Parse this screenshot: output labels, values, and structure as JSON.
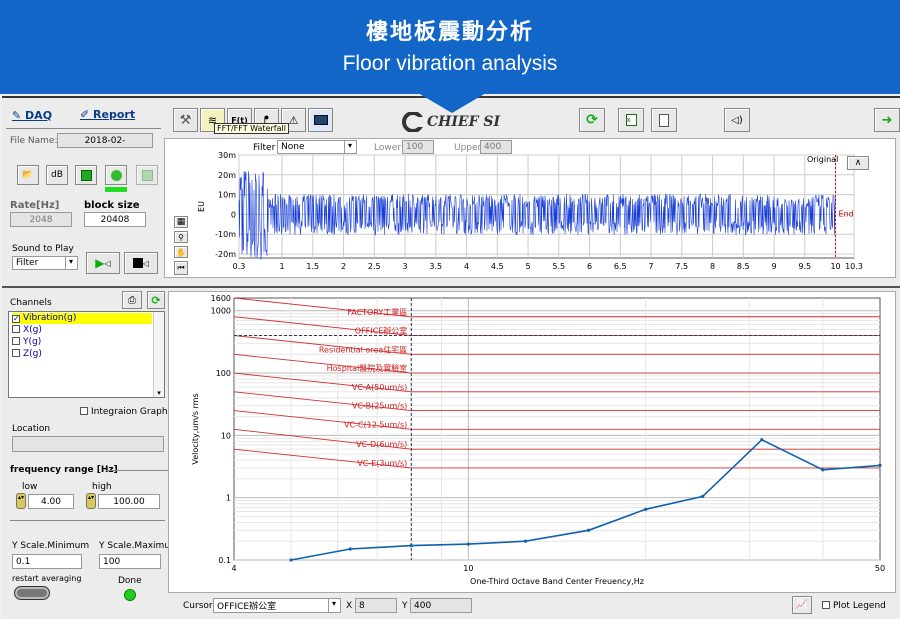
{
  "banner": {
    "title_zh": "樓地板震動分析",
    "title_en": "Floor vibration analysis"
  },
  "tabs": {
    "daq": "DAQ",
    "report": "Report"
  },
  "file": {
    "label": "File Name:",
    "value": "2018-02-"
  },
  "toolbar_left": {
    "db": "dB"
  },
  "rate": {
    "label": "Rate[Hz]",
    "value": "2048"
  },
  "block": {
    "label": "block size",
    "value": "20408"
  },
  "sound": {
    "label": "Sound to Play",
    "value": "Filter"
  },
  "top_toolbar": {
    "fft_button": "F(t)",
    "tooltip": "FFT/FFT Waterfall"
  },
  "brand": {
    "name": "CHIEF SI"
  },
  "filter": {
    "label": "Filter",
    "value": "None",
    "lower_label": "Lower",
    "lower_value": "100",
    "upper_label": "Upper",
    "upper_value": "400"
  },
  "chart_data": [
    {
      "type": "line",
      "ylabel": "EU",
      "x_ticks": [
        "0.3",
        "1",
        "1.5",
        "2",
        "2.5",
        "3",
        "3.5",
        "4",
        "4.5",
        "5",
        "5.5",
        "6",
        "6.5",
        "7",
        "7.5",
        "8",
        "8.5",
        "9",
        "9.5",
        "10",
        "10.3"
      ],
      "x_tick_values": [
        0.3,
        1,
        1.5,
        2,
        2.5,
        3,
        3.5,
        4,
        4.5,
        5,
        5.5,
        6,
        6.5,
        7,
        7.5,
        8,
        8.5,
        9,
        9.5,
        10,
        10.3
      ],
      "xlim": [
        0.3,
        10.3
      ],
      "y_ticks": [
        "30m",
        "20m",
        "10m",
        "0",
        "-10m",
        "-20m"
      ],
      "y_tick_values": [
        0.03,
        0.02,
        0.01,
        0,
        -0.01,
        -0.02
      ],
      "ylim": [
        -0.022,
        0.03
      ],
      "legend": "Original",
      "marker": {
        "label": "End",
        "x": 10
      },
      "grid": true
    },
    {
      "type": "line",
      "xlabel": "One-Third Octave Band Center Freuency,Hz",
      "ylabel": "Velocity,um/s rms",
      "x_scale": "log",
      "y_scale": "log",
      "xlim": [
        4,
        50
      ],
      "ylim": [
        0.1,
        1600
      ],
      "x_ticks": [
        {
          "label": "4",
          "value": 4
        },
        {
          "label": "10",
          "value": 10
        },
        {
          "label": "50",
          "value": 50
        }
      ],
      "y_ticks": [
        {
          "label": "1600",
          "value": 1600
        },
        {
          "label": "1000",
          "value": 1000
        },
        {
          "label": "100",
          "value": 100
        },
        {
          "label": "10",
          "value": 10
        },
        {
          "label": "1",
          "value": 1
        },
        {
          "label": "0.1",
          "value": 0.1
        }
      ],
      "grid": true,
      "series": [
        {
          "color": "#1060b0",
          "x": [
            5,
            6.3,
            8,
            10,
            12.5,
            16,
            20,
            25,
            31.5,
            40,
            50
          ],
          "y": [
            0.1,
            0.15,
            0.17,
            0.18,
            0.2,
            0.3,
            0.65,
            1.05,
            8.5,
            2.8,
            3.3
          ]
        }
      ],
      "criteria": [
        {
          "label": "FACTORY工業區",
          "start": 1600,
          "end": 800
        },
        {
          "label": "OFFICE辦公室",
          "start": 800,
          "end": 400
        },
        {
          "label": "Residential area住宅區",
          "start": 400,
          "end": 200
        },
        {
          "label": "Hospital醫院及實驗室",
          "start": 200,
          "end": 100
        },
        {
          "label": "VC-A(50um/s)",
          "start": 100,
          "end": 50
        },
        {
          "label": "VC-B(25um/s)",
          "start": 50,
          "end": 25
        },
        {
          "label": "VC-C(12.5um/s)",
          "start": 25,
          "end": 12.5
        },
        {
          "label": "VC-D(6um/s)",
          "start": 12.5,
          "end": 6
        },
        {
          "label": "VC-E(3um/s)",
          "start": 6,
          "end": 3
        }
      ],
      "cursor": {
        "x": 8,
        "y": 400
      }
    }
  ],
  "channels": {
    "label": "Channels",
    "items": [
      {
        "label": "Vibration(g)",
        "checked": true
      },
      {
        "label": "X(g)",
        "checked": false
      },
      {
        "label": "Y(g)",
        "checked": false
      },
      {
        "label": "Z(g)",
        "checked": false
      }
    ]
  },
  "integration": {
    "label": "Integraion Graph"
  },
  "location": {
    "label": "Location",
    "value": ""
  },
  "freq_range": {
    "label": "frequency range [Hz]",
    "low_label": "low",
    "low_value": "4.00",
    "high_label": "high",
    "high_value": "100.00"
  },
  "yscale": {
    "min_label": "Y Scale.Minimum",
    "min_value": "0.1",
    "max_label": "Y Scale.Maximum",
    "max_value": "100"
  },
  "restart": {
    "label": "restart averaging"
  },
  "done": {
    "label": "Done"
  },
  "cursor_bar": {
    "label": "Cursor",
    "value": "OFFICE辦公室",
    "x_label": "X",
    "x_value": "8",
    "y_label": "Y",
    "y_value": "400"
  },
  "plot_legend": {
    "label": "Plot Legend"
  }
}
